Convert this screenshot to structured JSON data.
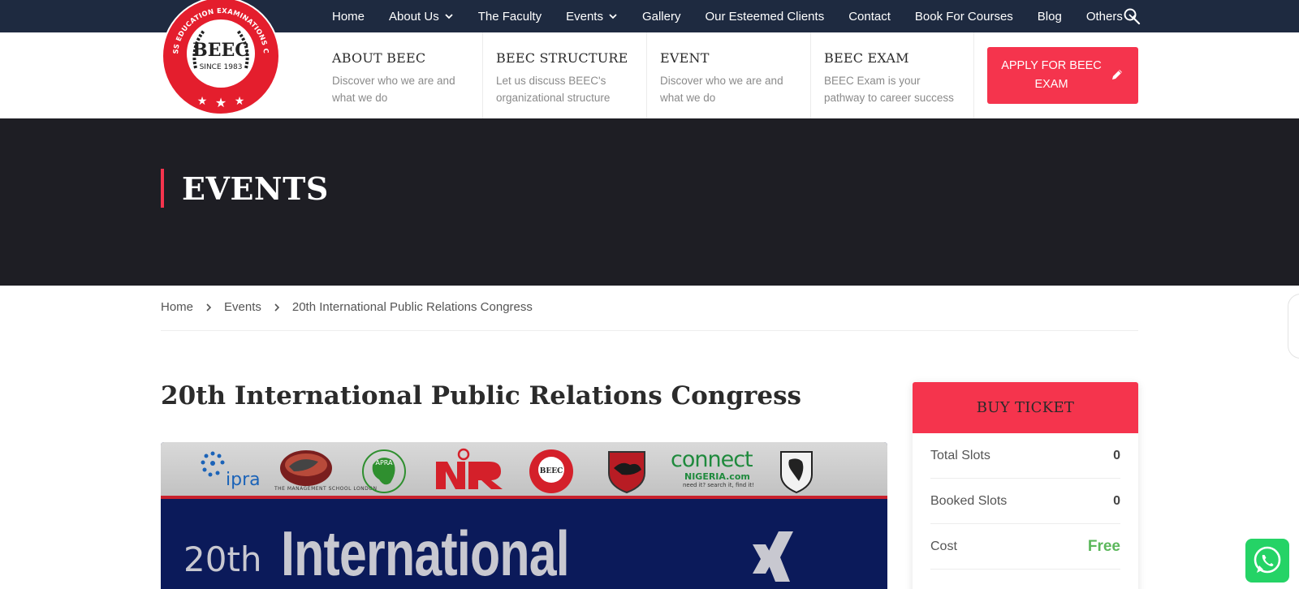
{
  "brand": {
    "logo_text": "BEEC",
    "logo_since": "SINCE 1983",
    "logo_ring_text": "BUSINESS EDUCATION EXAMINATIONS COUNCIL",
    "color_accent": "#f5344d",
    "color_nav_bg": "#1e2a40",
    "color_banner_bg": "#1e1e24"
  },
  "topnav": {
    "items": [
      {
        "label": "Home",
        "has_dropdown": false
      },
      {
        "label": "About Us",
        "has_dropdown": true
      },
      {
        "label": "The Faculty",
        "has_dropdown": false
      },
      {
        "label": "Events",
        "has_dropdown": true
      },
      {
        "label": "Gallery",
        "has_dropdown": false
      },
      {
        "label": "Our Esteemed Clients",
        "has_dropdown": false
      },
      {
        "label": "Contact",
        "has_dropdown": false
      },
      {
        "label": "Book For Courses",
        "has_dropdown": false
      },
      {
        "label": "Blog",
        "has_dropdown": false
      },
      {
        "label": "Others",
        "has_dropdown": true
      }
    ],
    "search_icon": "search-icon"
  },
  "infobar": {
    "columns": [
      {
        "title": "ABOUT BEEC",
        "desc": "Discover who we are and what we do"
      },
      {
        "title": "BEEC STRUCTURE",
        "desc": "Let us discuss BEEC's organizational structure"
      },
      {
        "title": "EVENT",
        "desc": "Discover who we are and what we do"
      },
      {
        "title": "BEEC EXAM",
        "desc": "BEEC Exam is your pathway to career success"
      }
    ],
    "apply_button": "APPLY FOR BEEC EXAM"
  },
  "banner": {
    "title": "EVENTS"
  },
  "breadcrumb": {
    "items": [
      "Home",
      "Events",
      "20th International Public Relations Congress"
    ]
  },
  "event": {
    "title": "20th International Public Relations Congress",
    "poster": {
      "partner_ipra": "ipra",
      "partner_tms": "THE MANAGEMENT SCHOOL LONDON",
      "partner_connect": "connect",
      "partner_nigeria": "NIGERIA.com",
      "partner_nigeria_sub": "need it? search it, find it!",
      "headline_number": "20th",
      "headline_word": "International"
    }
  },
  "ticket": {
    "heading": "BUY TICKET",
    "rows": [
      {
        "label": "Total Slots",
        "value": "0"
      },
      {
        "label": "Booked Slots",
        "value": "0"
      },
      {
        "label": "Cost",
        "value": "Free"
      }
    ],
    "free_color": "#5cb85c"
  },
  "whatsapp": {
    "icon": "whatsapp-icon"
  }
}
